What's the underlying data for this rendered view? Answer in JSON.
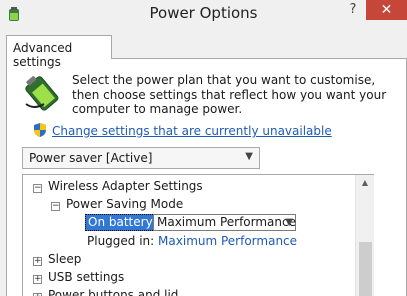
{
  "window": {
    "title": "Power Options",
    "help_label": "?",
    "close_label": "✕"
  },
  "tabs": [
    {
      "label": "Advanced settings"
    }
  ],
  "intro": {
    "description": "Select the power plan that you want to customise, then choose settings that reflect how you want your computer to manage power.",
    "change_link": "Change settings that are currently unavailable"
  },
  "plan_select": {
    "value": "Power saver [Active]"
  },
  "tree": {
    "wireless": {
      "label": "Wireless Adapter Settings",
      "toggle": "−"
    },
    "power_saving": {
      "label": "Power Saving Mode",
      "toggle": "−"
    },
    "on_battery": {
      "label": "On battery:",
      "value": "Maximum Performance"
    },
    "plugged_in": {
      "label": "Plugged in:",
      "value": "Maximum Performance"
    },
    "sleep": {
      "label": "Sleep",
      "toggle": "+"
    },
    "usb": {
      "label": "USB settings",
      "toggle": "+"
    },
    "power_buttons": {
      "label": "Power buttons and lid",
      "toggle": "+"
    }
  },
  "colors": {
    "close": "#c7463a",
    "selection": "#3178d6",
    "link": "#1f5ab5"
  }
}
